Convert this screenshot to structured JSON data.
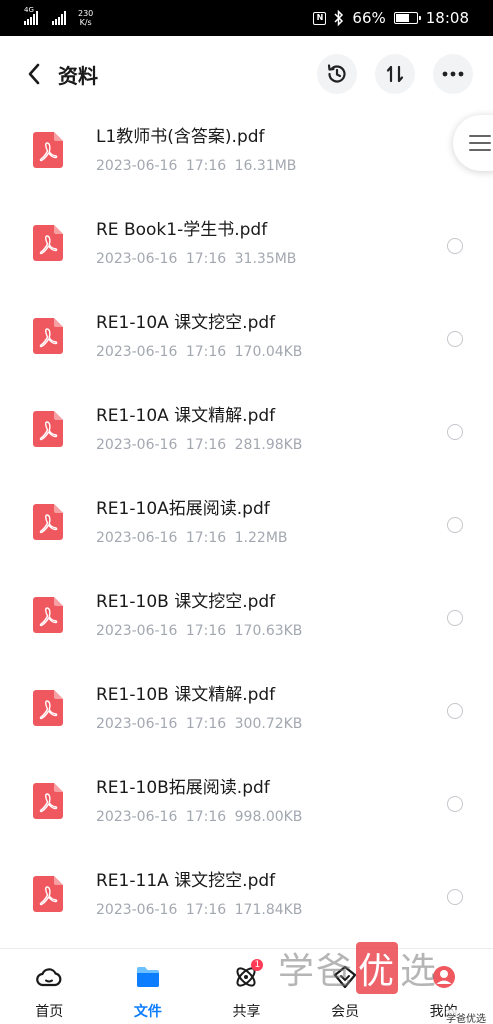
{
  "status_bar": {
    "network_1": "4G",
    "speed_value": "230",
    "speed_unit": "K/s",
    "nfc": "N",
    "battery": "66%",
    "battery_level": 0.66,
    "time": "18:08"
  },
  "header": {
    "title": "资料"
  },
  "files": [
    {
      "name": "L1教师书(含答案).pdf",
      "date": "2023-06-16",
      "time": "17:16",
      "size": "16.31MB"
    },
    {
      "name": "RE Book1-学生书.pdf",
      "date": "2023-06-16",
      "time": "17:16",
      "size": "31.35MB"
    },
    {
      "name": "RE1-10A 课文挖空.pdf",
      "date": "2023-06-16",
      "time": "17:16",
      "size": "170.04KB"
    },
    {
      "name": "RE1-10A 课文精解.pdf",
      "date": "2023-06-16",
      "time": "17:16",
      "size": "281.98KB"
    },
    {
      "name": "RE1-10A拓展阅读.pdf",
      "date": "2023-06-16",
      "time": "17:16",
      "size": "1.22MB"
    },
    {
      "name": "RE1-10B 课文挖空.pdf",
      "date": "2023-06-16",
      "time": "17:16",
      "size": "170.63KB"
    },
    {
      "name": "RE1-10B 课文精解.pdf",
      "date": "2023-06-16",
      "time": "17:16",
      "size": "300.72KB"
    },
    {
      "name": "RE1-10B拓展阅读.pdf",
      "date": "2023-06-16",
      "time": "17:16",
      "size": "998.00KB"
    },
    {
      "name": "RE1-11A 课文挖空.pdf",
      "date": "2023-06-16",
      "time": "17:16",
      "size": "171.84KB"
    }
  ],
  "nav": {
    "items": [
      {
        "label": "首页",
        "icon": "cloud-icon"
      },
      {
        "label": "文件",
        "icon": "folder-icon"
      },
      {
        "label": "共享",
        "icon": "share-atom-icon"
      },
      {
        "label": "会员",
        "icon": "member-icon"
      },
      {
        "label": "我的",
        "icon": "profile-icon"
      }
    ],
    "active_index": 1,
    "share_badge": "1"
  },
  "watermark": {
    "main_1": "学",
    "main_2": "爸",
    "main_3": "优",
    "main_4": "选",
    "small": "学爸优选"
  },
  "colors": {
    "accent": "#0c7dff",
    "pdf_red": "#f0585f",
    "meta_gray": "#a3a8b0",
    "badge": "#ff3b55"
  }
}
